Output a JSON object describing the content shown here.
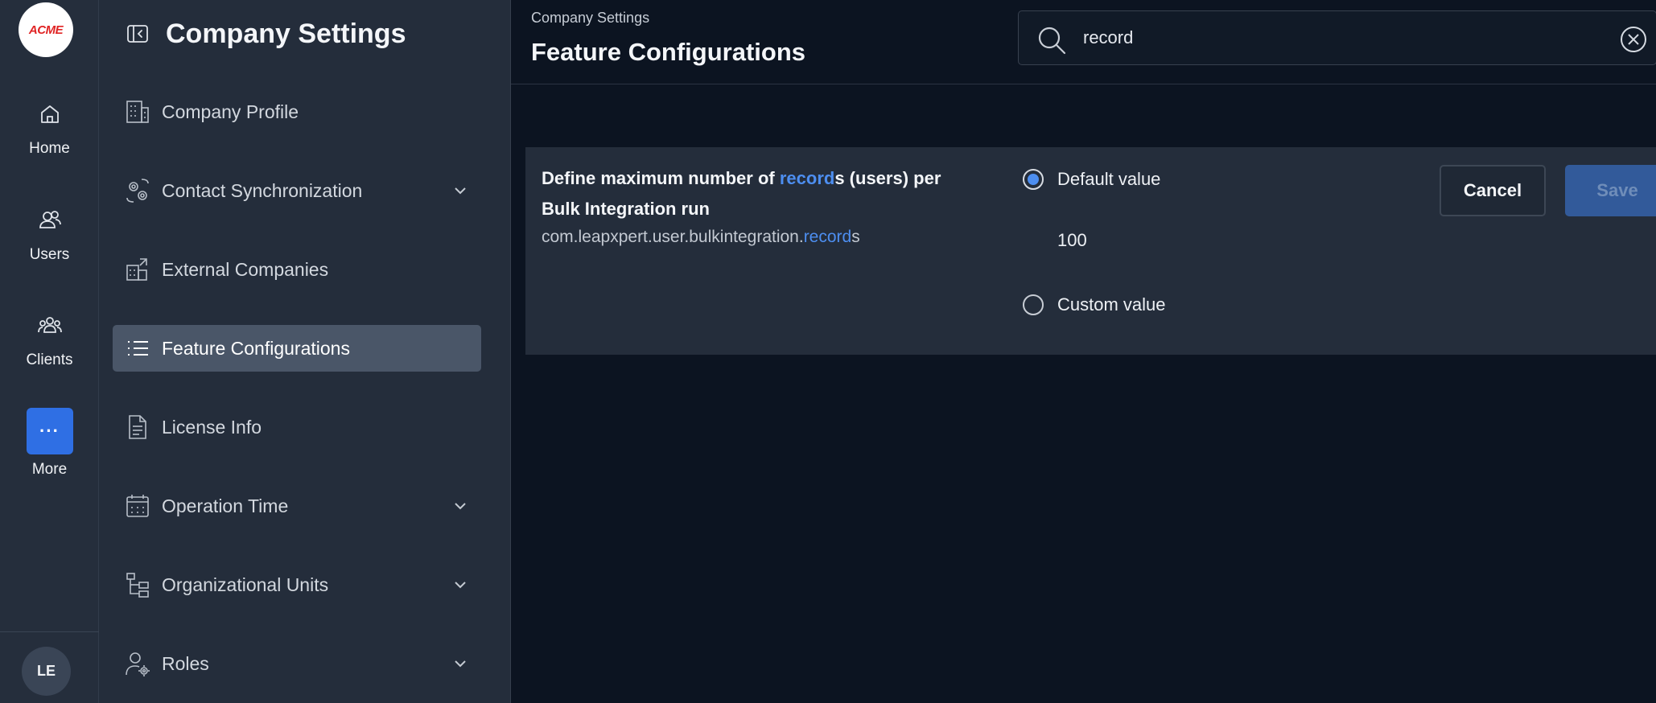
{
  "rail": {
    "logo_text": "ACME",
    "items": [
      {
        "label": "Home",
        "icon": "home-icon"
      },
      {
        "label": "Users",
        "icon": "users-icon"
      },
      {
        "label": "Clients",
        "icon": "clients-icon"
      },
      {
        "label": "More",
        "icon": "more-icon",
        "glyph": "···"
      }
    ],
    "avatar_initials": "LE"
  },
  "sidebar": {
    "title": "Company Settings",
    "items": [
      {
        "label": "Company Profile",
        "icon": "building-icon",
        "expandable": false,
        "active": false
      },
      {
        "label": "Contact Synchronization",
        "icon": "sync-gears-icon",
        "expandable": true,
        "active": false
      },
      {
        "label": "External Companies",
        "icon": "external-buildings-icon",
        "expandable": false,
        "active": false
      },
      {
        "label": "Feature Configurations",
        "icon": "list-icon",
        "expandable": false,
        "active": true
      },
      {
        "label": "License Info",
        "icon": "document-icon",
        "expandable": false,
        "active": false
      },
      {
        "label": "Operation Time",
        "icon": "calendar-icon",
        "expandable": true,
        "active": false
      },
      {
        "label": "Organizational Units",
        "icon": "org-tree-icon",
        "expandable": true,
        "active": false
      },
      {
        "label": "Roles",
        "icon": "user-gear-icon",
        "expandable": true,
        "active": false
      }
    ]
  },
  "header": {
    "breadcrumb": "Company Settings",
    "title": "Feature Configurations"
  },
  "search": {
    "value": "record",
    "placeholder": ""
  },
  "config": {
    "title_pre": "Define maximum number of ",
    "title_hl": "record",
    "title_post": "s (users) per Bulk Integration run",
    "key_pre": "com.leapxpert.user.bulkintegration.",
    "key_hl": "record",
    "key_post": "s",
    "options": [
      {
        "label": "Default value",
        "selected": true
      },
      {
        "label": "Custom value",
        "selected": false
      }
    ],
    "default_value": "100",
    "cancel_label": "Cancel",
    "save_label": "Save"
  },
  "colors": {
    "accent": "#2f6fe4",
    "highlight": "#4d8ef0",
    "background": "#0c1421",
    "panel": "#242d3b",
    "logo_red": "#e02424"
  }
}
